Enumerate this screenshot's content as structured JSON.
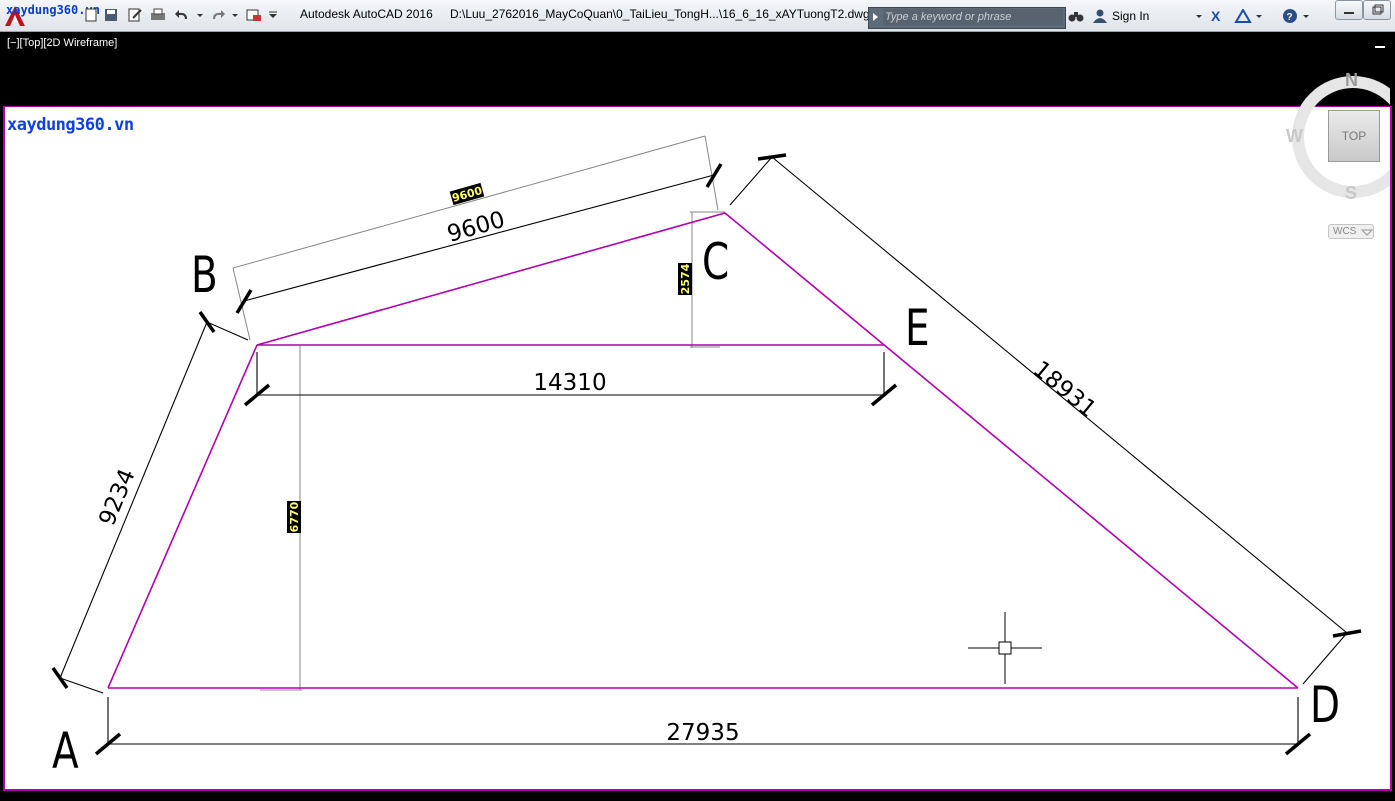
{
  "titlebar": {
    "watermark": "xaydung360.vn",
    "app_name": "Autodesk AutoCAD 2016",
    "file_path": "D:\\Luu_2762016_MayCoQuan\\0_TaiLieu_TongH...\\16_6_16_xAYTuongT2.dwg",
    "search_placeholder": "Type a keyword or phrase",
    "sign_in_label": "Sign In",
    "quick_access_icons": [
      "new-icon",
      "open-icon",
      "save-icon",
      "saveas-icon",
      "plot-icon",
      "undo-icon",
      "redo-icon",
      "workspace-icon",
      "dropdown-icon"
    ],
    "toolbar_icons": [
      "binoculars-icon",
      "user-icon",
      "exchange-icon",
      "a360-icon",
      "help-icon"
    ]
  },
  "viewport": {
    "view_label": "[−][Top][2D Wireframe]",
    "watermark": "xaydung360.vn",
    "background": "#ffffff",
    "boundary_color": "#b000b0",
    "dimension_color": "#000000"
  },
  "viewcube": {
    "north": "N",
    "west": "W",
    "south": "S",
    "face": "TOP",
    "wcs_label": "WCS"
  },
  "drawing": {
    "points": {
      "A": "A",
      "B": "B",
      "C": "C",
      "D": "D",
      "E": "E"
    },
    "dimensions": {
      "ab": "9234",
      "bc": "9600",
      "bc_highlight": "9600",
      "cd": "18931",
      "be": "14310",
      "ad": "27935",
      "c_height": "2574",
      "b_height": "6770"
    }
  }
}
